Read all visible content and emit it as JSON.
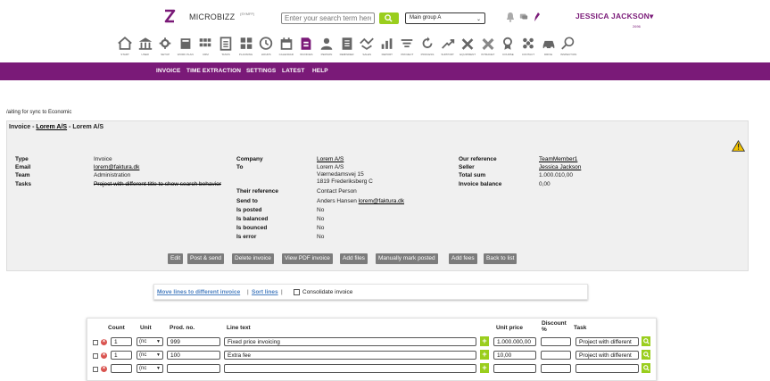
{
  "header": {
    "brand": "MICROBIZZ",
    "brand_sub": "(SYMFF)",
    "search_placeholder": "Enter your search term here",
    "group_select": "Main group A",
    "user_name": "JESSICA JACKSON",
    "user_sub": "2696",
    "accent_color": "#7a1a78",
    "modules": [
      {
        "label": "START",
        "icon": "home-icon"
      },
      {
        "label": "USER",
        "icon": "bank-icon"
      },
      {
        "label": "SETUP",
        "icon": "gear-icon"
      },
      {
        "label": "WORK PLAN",
        "icon": "workplan-icon"
      },
      {
        "label": "CRM",
        "icon": "crm-icon"
      },
      {
        "label": "TASKS",
        "icon": "tasks-icon"
      },
      {
        "label": "PLANNING",
        "icon": "planning-icon"
      },
      {
        "label": "HOURS",
        "icon": "clock-icon"
      },
      {
        "label": "CALENDAR",
        "icon": "calendar-icon"
      },
      {
        "label": "INVOICES",
        "icon": "invoice-icon"
      },
      {
        "label": "PERSON",
        "icon": "person-icon"
      },
      {
        "label": "REMINDER",
        "icon": "reminder-icon"
      },
      {
        "label": "SALES",
        "icon": "sales-icon"
      },
      {
        "label": "REPORT",
        "icon": "report-icon"
      },
      {
        "label": "PROJECT",
        "icon": "project-icon"
      },
      {
        "label": "PROCESS",
        "icon": "process-icon"
      },
      {
        "label": "SUPPORT",
        "icon": "support-icon"
      },
      {
        "label": "EQUIPMENT",
        "icon": "equipment-icon"
      },
      {
        "label": "INTRANET",
        "icon": "intranet-icon"
      },
      {
        "label": "COURSE",
        "icon": "course-icon"
      },
      {
        "label": "CONTACT",
        "icon": "contact-icon"
      },
      {
        "label": "DRIVE",
        "icon": "car-icon"
      },
      {
        "label": "INSPECTION",
        "icon": "inspection-icon"
      }
    ]
  },
  "menu": [
    "INVOICE",
    "TIME EXTRACTION",
    "SETTINGS",
    "LATEST",
    "HELP"
  ],
  "sync_text": "/aiting for sync to Economic",
  "card": {
    "title_prefix": "Invoice - ",
    "title_link": "Lorem A/S",
    "title_suffix": " - Lorem A/S",
    "col1": {
      "type_label": "Type",
      "type_value": "Invoice",
      "email_label": "Email",
      "email_value": "lorem@faktura.dk",
      "team_label": "Team",
      "team_value": "Administration",
      "tasks_label": "Tasks",
      "tasks_value": "Project with different title to show search behavior"
    },
    "col2": {
      "company_label": "Company",
      "company_value": "Lorem A/S",
      "to_label": "To",
      "to_line1": "Lorem A/S",
      "to_line2": "Værnedamsvej 15",
      "to_line3": "1819 Frederiksberg C",
      "their_ref_label": "Their reference",
      "their_ref_value": "Contact Person",
      "send_to_label": "Send to",
      "send_to_name": "Anders Hansen ",
      "send_to_email": "lorem@faktura.dk",
      "posted_label": "Is posted",
      "posted_value": "No",
      "balanced_label": "Is balanced",
      "balanced_value": "No",
      "bounced_label": "Is bounced",
      "bounced_value": "No",
      "error_label": "Is error",
      "error_value": "No"
    },
    "col3": {
      "our_ref_label": "Our reference",
      "our_ref_value": "TeamMember1",
      "seller_label": "Seller",
      "seller_value": "Jessica Jackson",
      "total_label": "Total sum",
      "total_value": "1.000.010,00",
      "balance_label": "Invoice balance",
      "balance_value": "0,00"
    },
    "buttons": [
      "Edit",
      "Post & send",
      "Delete invoice",
      "View PDF invoice",
      "Add files",
      "Manually mark posted",
      "Add fees",
      "Back to list"
    ]
  },
  "actions": {
    "move_lines": "Move lines to different invoice",
    "sep1": "|",
    "sort_lines": "Sort lines",
    "sep2": "|",
    "consolidate": "Consolidate invoice"
  },
  "lines": {
    "headers": {
      "count": "Count",
      "unit": "Unit",
      "prod_no": "Prod. no.",
      "line_text": "Line text",
      "unit_price": "Unit price",
      "discount": "Discount %",
      "task": "Task"
    },
    "rows": [
      {
        "count": "1",
        "unit": "(nc",
        "prod_no": "999",
        "line_text": "Fixed price invoicing",
        "unit_price": "1.000.000,00",
        "discount": "",
        "task": "Project with different"
      },
      {
        "count": "1",
        "unit": "(nc",
        "prod_no": "100",
        "line_text": "Extra fee",
        "unit_price": "10,00",
        "discount": "",
        "task": "Project with different"
      },
      {
        "count": "",
        "unit": "(nc",
        "prod_no": "",
        "line_text": "",
        "unit_price": "",
        "discount": "",
        "task": ""
      }
    ]
  }
}
